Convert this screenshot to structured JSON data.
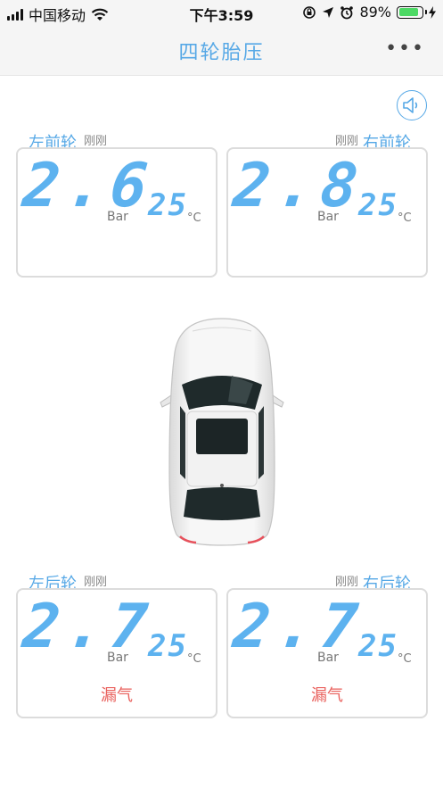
{
  "status_bar": {
    "carrier": "中国移动",
    "time": "下午3:59",
    "battery": "89%",
    "battery_level": 0.89
  },
  "nav": {
    "title": "四轮胎压",
    "more": "•••"
  },
  "tires": {
    "front_left": {
      "name": "左前轮",
      "updated": "刚刚",
      "pressure": "2.6",
      "pressure_unit": "Bar",
      "temp": "25",
      "temp_unit": "°C",
      "warning": ""
    },
    "front_right": {
      "name": "右前轮",
      "updated": "刚刚",
      "pressure": "2.8",
      "pressure_unit": "Bar",
      "temp": "25",
      "temp_unit": "°C",
      "warning": ""
    },
    "rear_left": {
      "name": "左后轮",
      "updated": "刚刚",
      "pressure": "2.7",
      "pressure_unit": "Bar",
      "temp": "25",
      "temp_unit": "°C",
      "warning": "漏气"
    },
    "rear_right": {
      "name": "右后轮",
      "updated": "刚刚",
      "pressure": "2.7",
      "pressure_unit": "Bar",
      "temp": "25",
      "temp_unit": "°C",
      "warning": "漏气"
    }
  },
  "icons": {
    "sound": "speaker-icon",
    "car": "car-top-view-icon"
  },
  "colors": {
    "accent": "#56a8e6",
    "value": "#5db2ef",
    "warning": "#e9605c",
    "card_border": "#dcdcdc"
  }
}
